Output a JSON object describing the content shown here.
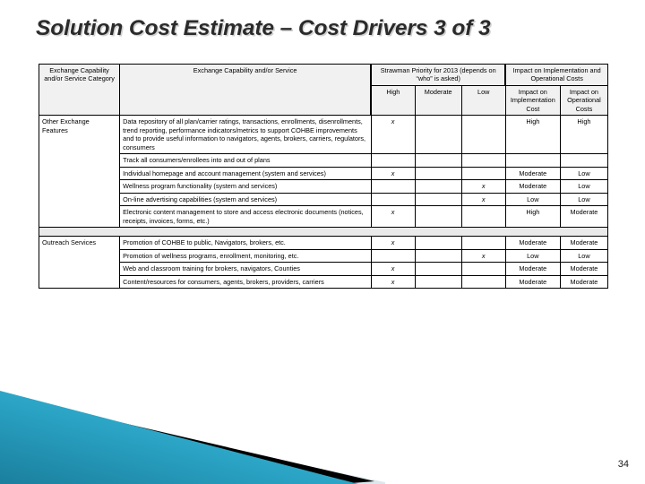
{
  "slide": {
    "title": "Solution Cost Estimate – Cost Drivers 3 of 3",
    "page_number": "34",
    "accent_color": "#2196b8",
    "decoration_light_color": "#dde8ee",
    "decoration_dark_color": "#000000"
  },
  "table": {
    "headers": {
      "category": "Exchange Capability and/or Service Category",
      "service": "Exchange Capability and/or Service",
      "priority_group": "Strawman Priority for 2013 (depends on “who” is asked)",
      "impact_group": "Impact on Implementation and Operational Costs",
      "high": "High",
      "moderate": "Moderate",
      "low": "Low",
      "impact_implementation": "Impact on Implementation Cost",
      "impact_operational": "Impact on Operational Costs"
    },
    "mark": "x",
    "sections": [
      {
        "category": "Other Exchange Features",
        "rows": [
          {
            "service": "Data repository of all plan/carrier ratings, transactions, enrollments, disenrollments, trend reporting, performance indicators/metrics to support COHBE improvements and to provide useful information to navigators, agents, brokers, carriers, regulators, consumers",
            "high": "x",
            "moderate": "",
            "low": "",
            "impact_implementation": "High",
            "impact_operational": "High"
          },
          {
            "service": "Track all consumers/enrollees into and out of plans",
            "high": "",
            "moderate": "",
            "low": "",
            "impact_implementation": "",
            "impact_operational": ""
          },
          {
            "service": "Individual homepage and account management (system and services)",
            "high": "x",
            "moderate": "",
            "low": "",
            "impact_implementation": "Moderate",
            "impact_operational": "Low"
          },
          {
            "service": "Wellness program functionality (system and services)",
            "high": "",
            "moderate": "",
            "low": "x",
            "impact_implementation": "Moderate",
            "impact_operational": "Low"
          },
          {
            "service": "On-line advertising capabilities (system and services)",
            "high": "",
            "moderate": "",
            "low": "x",
            "impact_implementation": "Low",
            "impact_operational": "Low"
          },
          {
            "service": "Electronic content management to store and access electronic documents (notices, receipts, invoices, forms, etc.)",
            "high": "x",
            "moderate": "",
            "low": "",
            "impact_implementation": "High",
            "impact_operational": "Moderate"
          }
        ]
      },
      {
        "category": "Outreach Services",
        "rows": [
          {
            "service": "Promotion of COHBE to public, Navigators, brokers, etc.",
            "high": "x",
            "moderate": "",
            "low": "",
            "impact_implementation": "Moderate",
            "impact_operational": "Moderate"
          },
          {
            "service": "Promotion of wellness programs, enrollment, monitoring, etc.",
            "high": "",
            "moderate": "",
            "low": "x",
            "impact_implementation": "Low",
            "impact_operational": "Low"
          },
          {
            "service": "Web and classroom training for brokers, navigators, Counties",
            "high": "x",
            "moderate": "",
            "low": "",
            "impact_implementation": "Moderate",
            "impact_operational": "Moderate"
          },
          {
            "service": "Content/resources for consumers, agents, brokers, providers, carriers",
            "high": "x",
            "moderate": "",
            "low": "",
            "impact_implementation": "Moderate",
            "impact_operational": "Moderate"
          }
        ]
      }
    ]
  }
}
